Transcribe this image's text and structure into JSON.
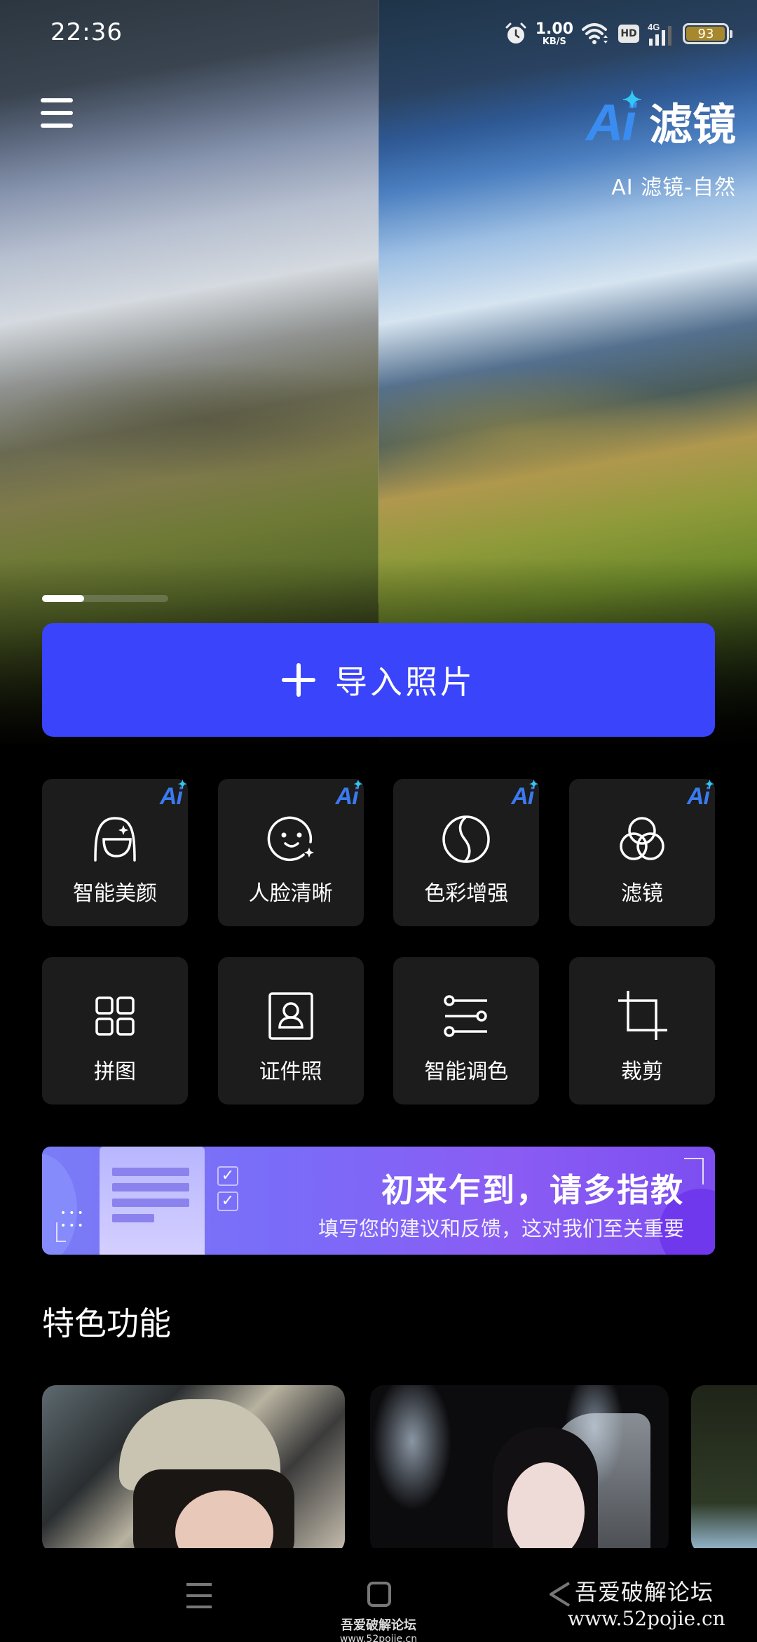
{
  "status_bar": {
    "time": "22:36",
    "net_speed_value": "1.00",
    "net_speed_unit": "KB/S",
    "hd_label": "HD",
    "network_type": "4G",
    "battery_level": "93",
    "icons": [
      "alarm-icon",
      "wifi-icon",
      "hd-icon",
      "signal-icon",
      "battery-icon"
    ]
  },
  "header": {
    "menu_icon": "hamburger-menu-icon",
    "brand_ai": "Ai",
    "brand_name": "滤镜",
    "brand_subtitle": "AI 滤镜-自然"
  },
  "hero": {
    "description": "before/after comparison of mountain landscape",
    "carousel_position": "1 of 3"
  },
  "import_button": {
    "icon": "plus-icon",
    "label": "导入照片"
  },
  "colors": {
    "accent": "#3a44fa",
    "tile_bg": "#1c1c1c",
    "ai_badge": "#3a7af0",
    "banner_start": "#7a7cf6",
    "banner_end": "#7d4ef0"
  },
  "tools_row1": [
    {
      "label": "智能美颜",
      "icon": "face-beauty-icon",
      "ai": "Ai"
    },
    {
      "label": "人脸清晰",
      "icon": "smile-face-icon",
      "ai": "Ai"
    },
    {
      "label": "色彩增强",
      "icon": "color-enhance-icon",
      "ai": "Ai"
    },
    {
      "label": "滤镜",
      "icon": "filter-circles-icon",
      "ai": "Ai"
    }
  ],
  "tools_row2": [
    {
      "label": "拼图",
      "icon": "collage-grid-icon"
    },
    {
      "label": "证件照",
      "icon": "id-photo-icon"
    },
    {
      "label": "智能调色",
      "icon": "adjust-sliders-icon"
    },
    {
      "label": "裁剪",
      "icon": "crop-icon"
    }
  ],
  "banner": {
    "title": "初来乍到，请多指教",
    "subtitle": "填写您的建议和反馈，这对我们至关重要"
  },
  "featured": {
    "title": "特色功能",
    "cards": [
      {
        "name": "portrait-cap-headphones"
      },
      {
        "name": "portrait-bride-veil"
      },
      {
        "name": "portrait-partial"
      }
    ]
  },
  "nav_bar": {
    "recent_icon": "recents-icon",
    "home_icon": "home-icon",
    "back_icon": "back-icon"
  },
  "watermark": {
    "center_name": "吾爱破解论坛",
    "center_url": "www.52pojie.cn",
    "right_name": "吾爱破解论坛",
    "right_url": "www.52pojie.cn"
  }
}
